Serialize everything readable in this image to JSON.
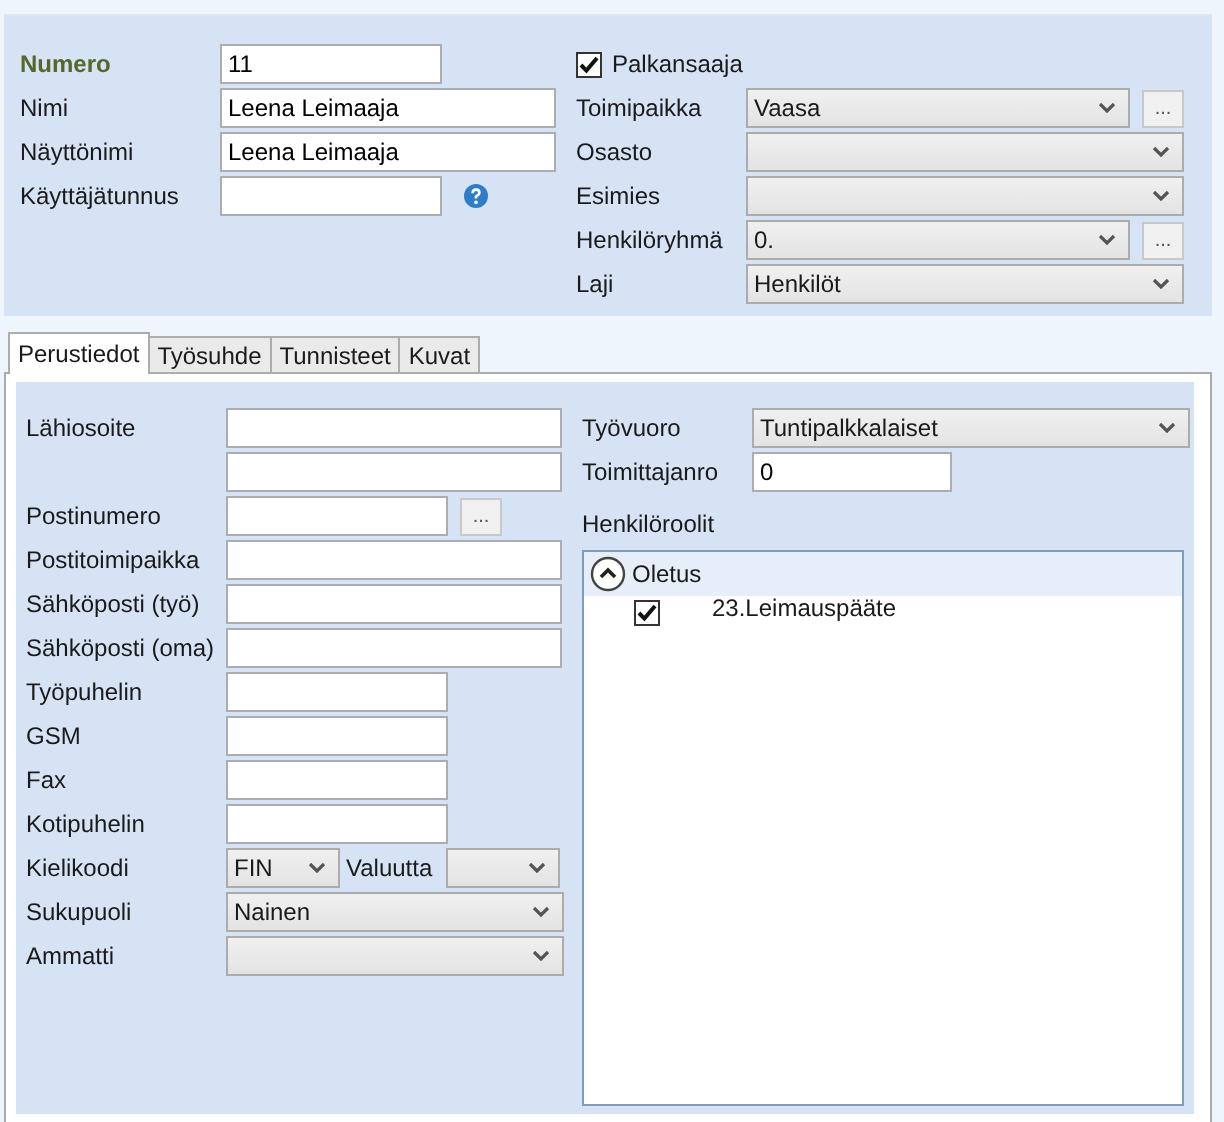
{
  "header": {
    "left": [
      {
        "label": "Numero",
        "emphasized": true,
        "kind": "short_text",
        "value": "11",
        "help": false
      },
      {
        "label": "Nimi",
        "emphasized": false,
        "kind": "text",
        "value": "Leena Leimaaja",
        "help": false
      },
      {
        "label": "Näyttönimi",
        "emphasized": false,
        "kind": "text",
        "value": "Leena Leimaaja",
        "help": false
      },
      {
        "label": "Käyttäjätunnus",
        "emphasized": false,
        "kind": "short_text",
        "help": true
      }
    ],
    "checkbox": {
      "label": "Palkansaaja",
      "checked": true
    },
    "right": [
      {
        "label": "Toimipaikka",
        "kind": "dropdown_button",
        "value": "Vaasa",
        "button": "..."
      },
      {
        "label": "Osasto",
        "kind": "dropdown"
      },
      {
        "label": "Esimies",
        "kind": "dropdown"
      },
      {
        "label": "Henkilöryhmä",
        "kind": "dropdown_button",
        "value": "0.",
        "button": "..."
      },
      {
        "label": "Laji",
        "kind": "dropdown",
        "value": "Henkilöt"
      }
    ]
  },
  "tabs": [
    {
      "label": "Perustiedot",
      "selected": true
    },
    {
      "label": "Työsuhde",
      "selected": false
    },
    {
      "label": "Tunnisteet",
      "selected": false
    },
    {
      "label": "Kuvat",
      "selected": false
    }
  ],
  "tab_content": {
    "left": [
      {
        "label": "Lähiosoite",
        "kind": "text"
      },
      {
        "kind": "text"
      },
      {
        "label": "Postinumero",
        "kind": "short_text_button",
        "button": "..."
      },
      {
        "label": "Postitoimipaikka",
        "kind": "text"
      },
      {
        "label": "Sähköposti (työ)",
        "kind": "text"
      },
      {
        "label": "Sähköposti (oma)",
        "kind": "text"
      },
      {
        "label": "Työpuhelin",
        "kind": "short_text"
      },
      {
        "label": "GSM",
        "kind": "short_text"
      },
      {
        "label": "Fax",
        "kind": "short_text"
      },
      {
        "label": "Kotipuhelin",
        "kind": "short_text"
      },
      {
        "label": "Kielikoodi",
        "kind": "dropdown_pair",
        "value": "FIN",
        "second_label": "Valuutta"
      },
      {
        "label": "Sukupuoli",
        "kind": "dropdown",
        "value": "Nainen"
      },
      {
        "label": "Ammatti",
        "kind": "dropdown"
      }
    ],
    "right": [
      {
        "label": "Työvuoro",
        "kind": "dropdown",
        "value": "Tuntipalkkalaiset"
      },
      {
        "label": "Toimittajanro",
        "kind": "short_text",
        "value": "0"
      }
    ],
    "roles": {
      "label": "Henkilöroolit",
      "groups": [
        {
          "title": "Oletus",
          "expanded": true,
          "children": [
            {
              "label": "23.Leimauspääte",
              "checked": true
            }
          ]
        }
      ]
    }
  }
}
